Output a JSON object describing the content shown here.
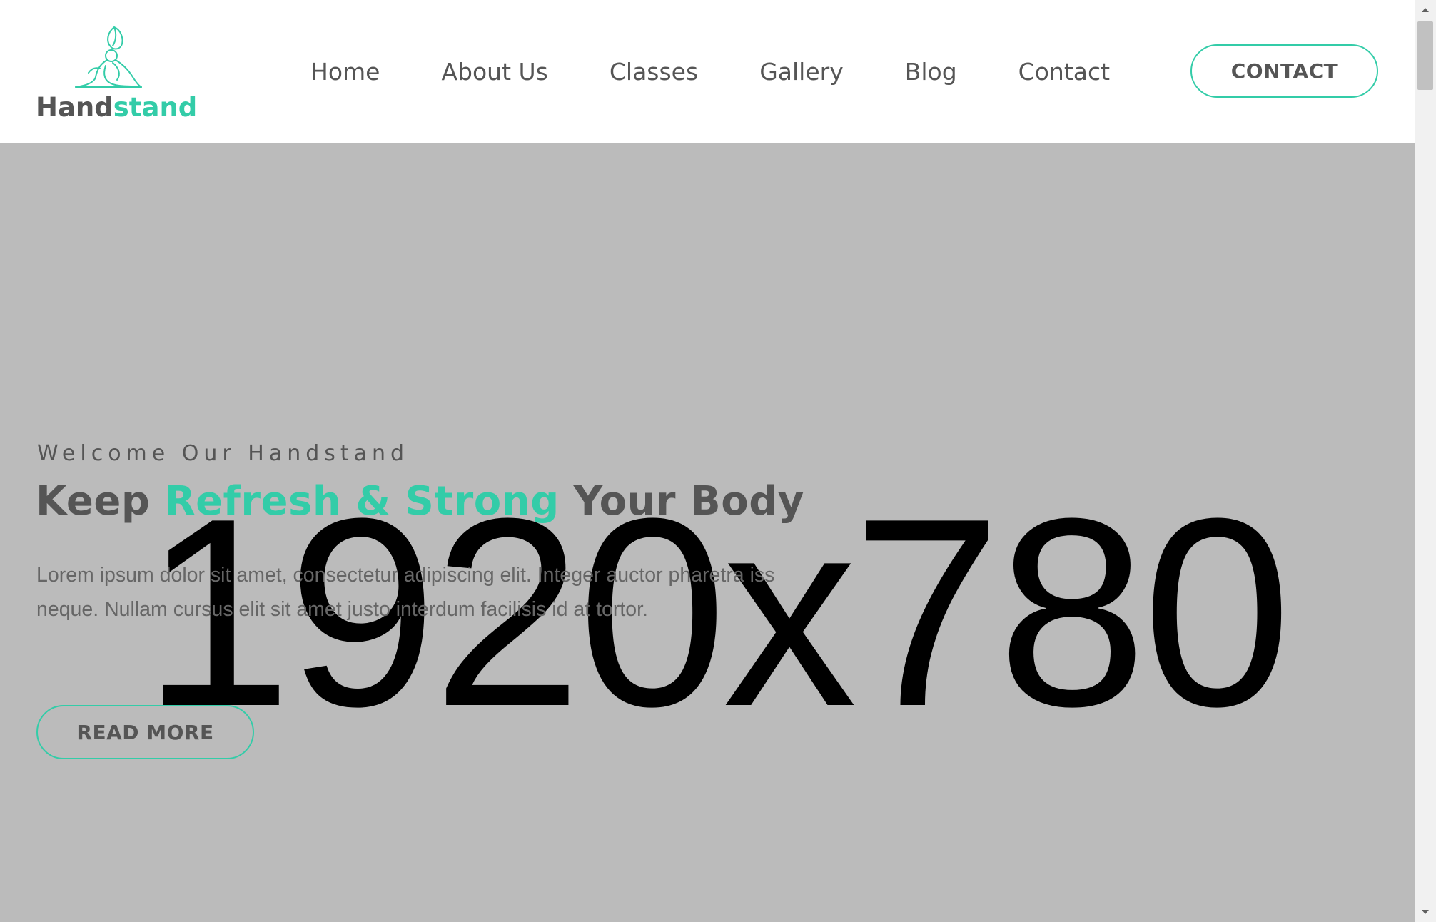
{
  "brand": {
    "name_part1": "Hand",
    "name_part2": "stand",
    "logo_icon": "yoga-pose-icon",
    "accent_color": "#33cca8"
  },
  "nav": {
    "items": [
      {
        "label": "Home"
      },
      {
        "label": "About Us"
      },
      {
        "label": "Classes"
      },
      {
        "label": "Gallery"
      },
      {
        "label": "Blog"
      },
      {
        "label": "Contact"
      }
    ],
    "cta_label": "CONTACT"
  },
  "hero": {
    "placeholder_text": "1920x780",
    "subtitle": "Welcome Our Handstand",
    "title_part1": "Keep ",
    "title_accent": "Refresh & Strong",
    "title_part2": " Your Body",
    "description": "Lorem ipsum dolor sit amet, consectetur adipiscing elit. Integer auctor pharetra iss neque. Nullam cursus elit sit amet justo interdum facilisis id at tortor.",
    "button_label": "READ MORE"
  },
  "scrollbar": {
    "up_icon": "scroll-up-arrow-icon",
    "down_icon": "scroll-down-arrow-icon"
  }
}
